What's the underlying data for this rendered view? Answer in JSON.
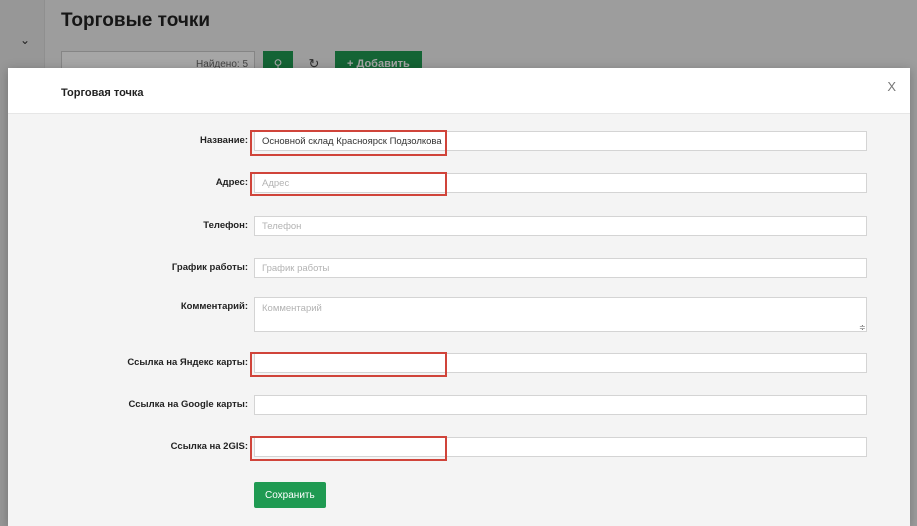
{
  "background": {
    "page_title": "Торговые точки",
    "search_hint": "Найдено: 5",
    "add_button_label": "+ Добавить"
  },
  "modal": {
    "title": "Торговая точка",
    "close_label": "X",
    "fields": {
      "name": {
        "label": "Название:",
        "value": "Основной склад Красноярск Подзолкова",
        "placeholder": ""
      },
      "address": {
        "label": "Адрес:",
        "value": "",
        "placeholder": "Адрес"
      },
      "phone": {
        "label": "Телефон:",
        "value": "",
        "placeholder": "Телефон"
      },
      "schedule": {
        "label": "График работы:",
        "value": "",
        "placeholder": "График работы"
      },
      "comment": {
        "label": "Комментарий:",
        "value": "",
        "placeholder": "Комментарий"
      },
      "yandex": {
        "label": "Ссылка на Яндекс карты:",
        "value": "",
        "placeholder": ""
      },
      "google": {
        "label": "Ссылка на Google карты:",
        "value": "",
        "placeholder": ""
      },
      "twogis": {
        "label": "Ссылка на 2GIS:",
        "value": "",
        "placeholder": ""
      }
    },
    "save_label": "Сохранить"
  },
  "colors": {
    "accent": "#1f9a52",
    "highlight": "#d0443a"
  }
}
